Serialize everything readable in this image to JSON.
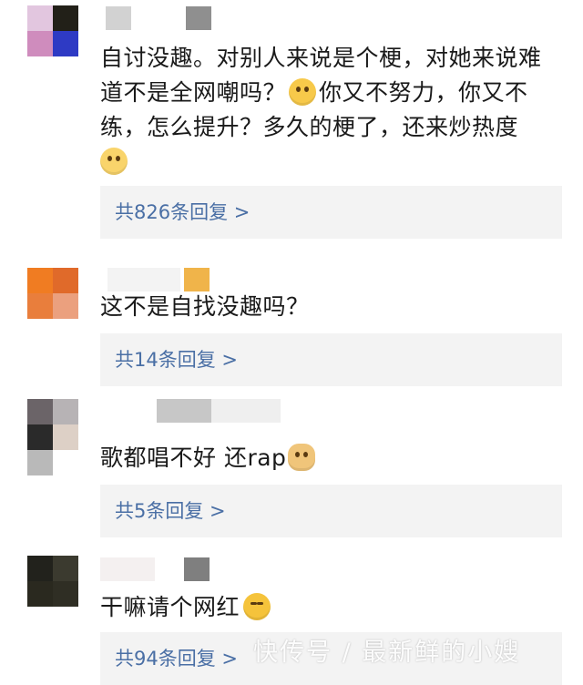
{
  "comments": [
    {
      "text_lines": [
        "自讨没趣。对别人来说是个梗，对她来说难",
        "道不是全网嘲吗？",
        "你又不努力，你又不",
        "练，怎么提升？多久的梗了，还来炒热度"
      ],
      "reply_label": "共826条回复 >",
      "emoji_icons": [
        "thinking-face-icon",
        "drooling-face-icon"
      ]
    },
    {
      "text": "这不是自找没趣吗？",
      "reply_label": "共14条回复 >"
    },
    {
      "text": "歌都唱不好 还rap",
      "reply_label": "共5条回复 >",
      "emoji_icons": [
        "doge-icon"
      ]
    },
    {
      "text": "干嘛请个网红",
      "reply_label": "共94条回复 >",
      "emoji_icons": [
        "laugh-cry-icon"
      ]
    }
  ],
  "watermark": "快传号 / 最新鲜的小嫂",
  "colors": {
    "reply_link": "#4a6fa5",
    "reply_bg": "#f3f3f3"
  }
}
